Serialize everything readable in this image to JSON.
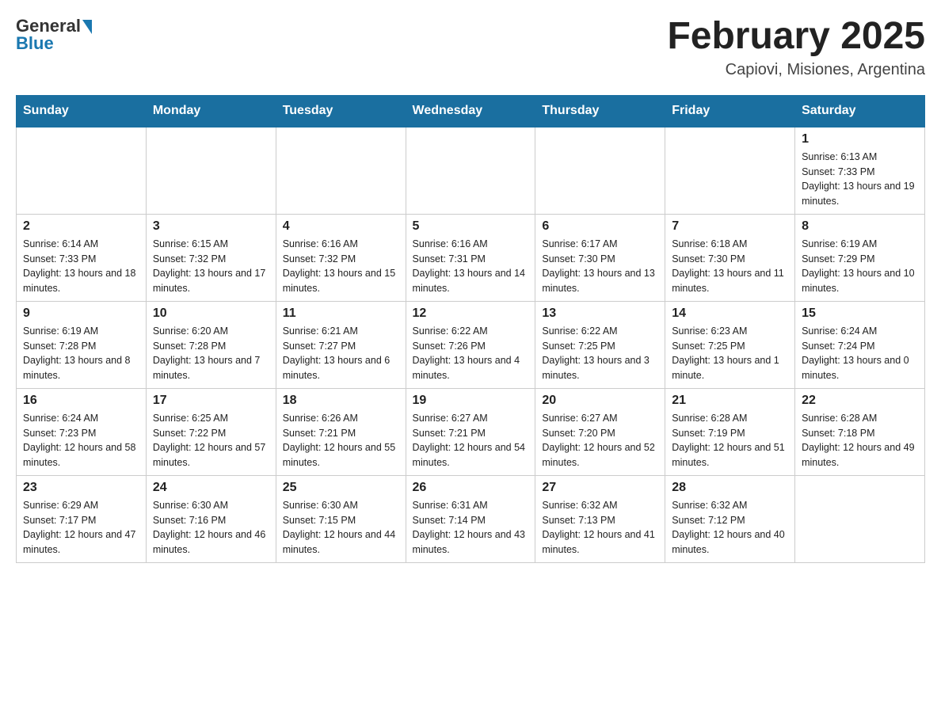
{
  "logo": {
    "general": "General",
    "blue": "Blue"
  },
  "title": "February 2025",
  "subtitle": "Capiovi, Misiones, Argentina",
  "days_of_week": [
    "Sunday",
    "Monday",
    "Tuesday",
    "Wednesday",
    "Thursday",
    "Friday",
    "Saturday"
  ],
  "weeks": [
    [
      {
        "day": "",
        "info": ""
      },
      {
        "day": "",
        "info": ""
      },
      {
        "day": "",
        "info": ""
      },
      {
        "day": "",
        "info": ""
      },
      {
        "day": "",
        "info": ""
      },
      {
        "day": "",
        "info": ""
      },
      {
        "day": "1",
        "info": "Sunrise: 6:13 AM\nSunset: 7:33 PM\nDaylight: 13 hours and 19 minutes."
      }
    ],
    [
      {
        "day": "2",
        "info": "Sunrise: 6:14 AM\nSunset: 7:33 PM\nDaylight: 13 hours and 18 minutes."
      },
      {
        "day": "3",
        "info": "Sunrise: 6:15 AM\nSunset: 7:32 PM\nDaylight: 13 hours and 17 minutes."
      },
      {
        "day": "4",
        "info": "Sunrise: 6:16 AM\nSunset: 7:32 PM\nDaylight: 13 hours and 15 minutes."
      },
      {
        "day": "5",
        "info": "Sunrise: 6:16 AM\nSunset: 7:31 PM\nDaylight: 13 hours and 14 minutes."
      },
      {
        "day": "6",
        "info": "Sunrise: 6:17 AM\nSunset: 7:30 PM\nDaylight: 13 hours and 13 minutes."
      },
      {
        "day": "7",
        "info": "Sunrise: 6:18 AM\nSunset: 7:30 PM\nDaylight: 13 hours and 11 minutes."
      },
      {
        "day": "8",
        "info": "Sunrise: 6:19 AM\nSunset: 7:29 PM\nDaylight: 13 hours and 10 minutes."
      }
    ],
    [
      {
        "day": "9",
        "info": "Sunrise: 6:19 AM\nSunset: 7:28 PM\nDaylight: 13 hours and 8 minutes."
      },
      {
        "day": "10",
        "info": "Sunrise: 6:20 AM\nSunset: 7:28 PM\nDaylight: 13 hours and 7 minutes."
      },
      {
        "day": "11",
        "info": "Sunrise: 6:21 AM\nSunset: 7:27 PM\nDaylight: 13 hours and 6 minutes."
      },
      {
        "day": "12",
        "info": "Sunrise: 6:22 AM\nSunset: 7:26 PM\nDaylight: 13 hours and 4 minutes."
      },
      {
        "day": "13",
        "info": "Sunrise: 6:22 AM\nSunset: 7:25 PM\nDaylight: 13 hours and 3 minutes."
      },
      {
        "day": "14",
        "info": "Sunrise: 6:23 AM\nSunset: 7:25 PM\nDaylight: 13 hours and 1 minute."
      },
      {
        "day": "15",
        "info": "Sunrise: 6:24 AM\nSunset: 7:24 PM\nDaylight: 13 hours and 0 minutes."
      }
    ],
    [
      {
        "day": "16",
        "info": "Sunrise: 6:24 AM\nSunset: 7:23 PM\nDaylight: 12 hours and 58 minutes."
      },
      {
        "day": "17",
        "info": "Sunrise: 6:25 AM\nSunset: 7:22 PM\nDaylight: 12 hours and 57 minutes."
      },
      {
        "day": "18",
        "info": "Sunrise: 6:26 AM\nSunset: 7:21 PM\nDaylight: 12 hours and 55 minutes."
      },
      {
        "day": "19",
        "info": "Sunrise: 6:27 AM\nSunset: 7:21 PM\nDaylight: 12 hours and 54 minutes."
      },
      {
        "day": "20",
        "info": "Sunrise: 6:27 AM\nSunset: 7:20 PM\nDaylight: 12 hours and 52 minutes."
      },
      {
        "day": "21",
        "info": "Sunrise: 6:28 AM\nSunset: 7:19 PM\nDaylight: 12 hours and 51 minutes."
      },
      {
        "day": "22",
        "info": "Sunrise: 6:28 AM\nSunset: 7:18 PM\nDaylight: 12 hours and 49 minutes."
      }
    ],
    [
      {
        "day": "23",
        "info": "Sunrise: 6:29 AM\nSunset: 7:17 PM\nDaylight: 12 hours and 47 minutes."
      },
      {
        "day": "24",
        "info": "Sunrise: 6:30 AM\nSunset: 7:16 PM\nDaylight: 12 hours and 46 minutes."
      },
      {
        "day": "25",
        "info": "Sunrise: 6:30 AM\nSunset: 7:15 PM\nDaylight: 12 hours and 44 minutes."
      },
      {
        "day": "26",
        "info": "Sunrise: 6:31 AM\nSunset: 7:14 PM\nDaylight: 12 hours and 43 minutes."
      },
      {
        "day": "27",
        "info": "Sunrise: 6:32 AM\nSunset: 7:13 PM\nDaylight: 12 hours and 41 minutes."
      },
      {
        "day": "28",
        "info": "Sunrise: 6:32 AM\nSunset: 7:12 PM\nDaylight: 12 hours and 40 minutes."
      },
      {
        "day": "",
        "info": ""
      }
    ]
  ]
}
